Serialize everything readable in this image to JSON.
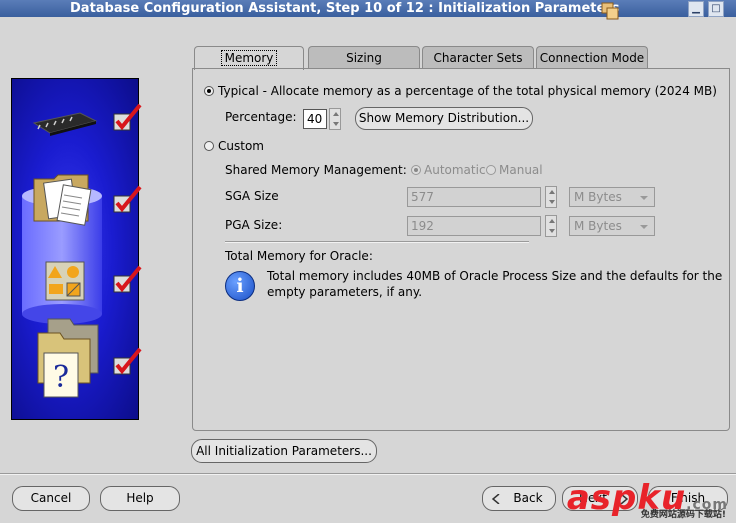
{
  "window": {
    "title": "Database Configuration Assistant, Step 10 of 12 : Initialization Parameters"
  },
  "tabs": [
    {
      "label": "Memory",
      "active": true
    },
    {
      "label": "Sizing",
      "active": false
    },
    {
      "label": "Character Sets",
      "active": false
    },
    {
      "label": "Connection Mode",
      "active": false
    }
  ],
  "memory": {
    "typical_label": "Typical - Allocate memory as a percentage of the total physical memory (2024 MB)",
    "typical_selected": true,
    "percentage_label": "Percentage:",
    "percentage_value": "40",
    "show_distribution_label": "Show Memory Distribution...",
    "custom_label": "Custom",
    "custom_selected": false,
    "shared_mgmt_label": "Shared Memory Management:",
    "automatic_label": "Automatic",
    "manual_label": "Manual",
    "sga_label": "SGA Size",
    "sga_value": "577",
    "sga_unit": "M Bytes",
    "pga_label": "PGA Size:",
    "pga_value": "192",
    "pga_unit": "M Bytes",
    "total_label": "Total Memory for Oracle:",
    "info_text_line1": "Total memory includes 40MB of Oracle Process Size and the defaults for the",
    "info_text_line2": "empty parameters, if any."
  },
  "all_params_label": "All Initialization Parameters...",
  "footer": {
    "cancel_label": "Cancel",
    "help_label": "Help",
    "back_label": "Back",
    "next_label": "Next",
    "finish_label": "Finish"
  },
  "watermark": {
    "brand": "aspku",
    "suffix": ".com",
    "tagline": "免费网站源码下载站!"
  },
  "colors": {
    "titlebar": "#3a5f9e",
    "side_panel": "#1a1cd0",
    "check_red": "#d8161c",
    "watermark_red": "#e8232a"
  }
}
